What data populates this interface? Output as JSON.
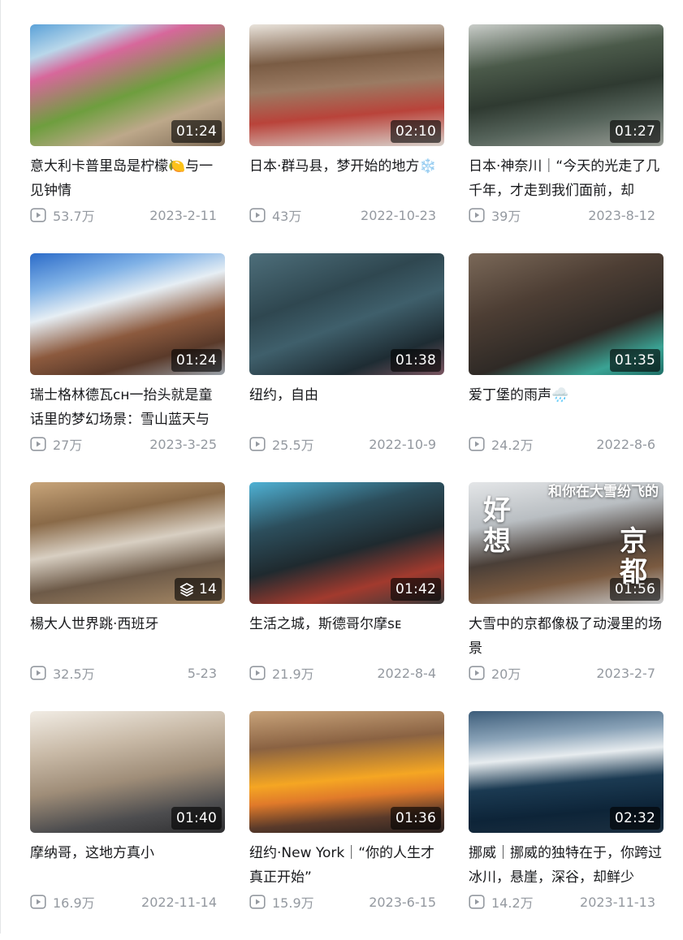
{
  "videos": [
    {
      "title": "意大利卡普里岛是柠檬🍋与一见钟情",
      "badge": "01:24",
      "views": "53.7万",
      "date": "2023-2-11",
      "thumb_bg": "linear-gradient(160deg,#5aa1d8 0%,#b9d7ea 18%,#d7679b 30%,#6e9e3e 55%,#bda88a 75%,#7d6a55 100%)"
    },
    {
      "title": "日本·群马县，梦开始的地方❄️",
      "badge": "02:10",
      "views": "43万",
      "date": "2022-10-23",
      "thumb_bg": "linear-gradient(175deg,#e9e3db 0%,#7a5c44 30%,#9b7b63 50%,#b9433a 72%,#d8d2cc 100%)"
    },
    {
      "title": "日本·神奈川｜“今天的光走了几千年，才走到我们面前，却",
      "badge": "01:27",
      "views": "39万",
      "date": "2023-8-12",
      "thumb_bg": "linear-gradient(170deg,#c9cdc9 0%,#4b5a4a 30%,#2f3a31 55%,#55635a 75%,#9a9e97 100%)"
    },
    {
      "title": "瑞士格林德瓦ᴄʜ一抬头就是童话里的梦幻场景：雪山蓝天与",
      "badge": "01:24",
      "views": "27万",
      "date": "2023-3-25",
      "thumb_bg": "linear-gradient(165deg,#2c6cc9 0%,#7fb1e6 22%,#e6eef4 40%,#8c5a3e 62%,#5a3a2a 80%,#9aa2aa 100%)"
    },
    {
      "title": "纽约，自由",
      "badge": "01:38",
      "views": "25.5万",
      "date": "2022-10-9",
      "thumb_bg": "linear-gradient(160deg,#4d6e7a 0%,#2f4750 35%,#3f5f6b 55%,#1e2c33 80%,#7a5560 100%)"
    },
    {
      "title": "爱丁堡的雨声🌧️",
      "badge": "01:35",
      "views": "24.2万",
      "date": "2022-8-6",
      "thumb_bg": "linear-gradient(160deg,#7a6858 0%,#4d3e34 35%,#2f2a26 65%,#3aa394 85%,#1f6f67 100%)"
    },
    {
      "title": "楊大人世界跳·西班牙",
      "badge": "14",
      "views": "32.5万",
      "date": "5-23",
      "thumb_bg": "linear-gradient(170deg,#c8a57a 0%,#8a6a48 28%,#d8cfc2 50%,#6d5a48 72%,#a88a66 100%)",
      "multi": true
    },
    {
      "title": "生活之城，斯德哥尔摩ꜱᴇ",
      "badge": "01:42",
      "views": "21.9万",
      "date": "2022-8-4",
      "thumb_bg": "linear-gradient(165deg,#4fb2d5 0%,#2c4e5c 30%,#1f2a2f 55%,#a23a2e 78%,#3a3a3a 100%)"
    },
    {
      "title": "大雪中的京都像极了动漫里的场景",
      "badge": "01:56",
      "views": "20万",
      "date": "2023-2-7",
      "thumb_bg": "linear-gradient(170deg,#e4e6e8 0%,#b9bec2 30%,#4a3f38 55%,#7a5a40 75%,#c9cbcd 100%)",
      "overlay": {
        "left": "好想",
        "right": "京都",
        "top": "和你在大雪纷飞的"
      }
    },
    {
      "title": "摩纳哥，这地方真小",
      "badge": "01:40",
      "views": "16.9万",
      "date": "2022-11-14",
      "thumb_bg": "linear-gradient(170deg,#f1ece4 0%,#c8b9a6 30%,#9f8d78 55%,#4d4d4f 80%,#2e2e30 100%)"
    },
    {
      "title": "纽约·New York｜“你的人生才真正开始”",
      "badge": "01:36",
      "views": "15.9万",
      "date": "2023-6-15",
      "thumb_bg": "linear-gradient(175deg,#c8a37a 0%,#8a6242 28%,#f5a623 55%,#e07a2a 68%,#5a3a2a 85%,#2a2220 100%)"
    },
    {
      "title": "挪威｜挪威的独特在于，你跨过冰川，悬崖，深谷，却鲜少",
      "badge": "02:32",
      "views": "14.2万",
      "date": "2023-11-13",
      "thumb_bg": "linear-gradient(175deg,#3d5d7a 0%,#8aa3b8 22%,#e7ecef 38%,#1b3a52 58%,#0d2438 80%,#1c2f40 100%)"
    }
  ]
}
